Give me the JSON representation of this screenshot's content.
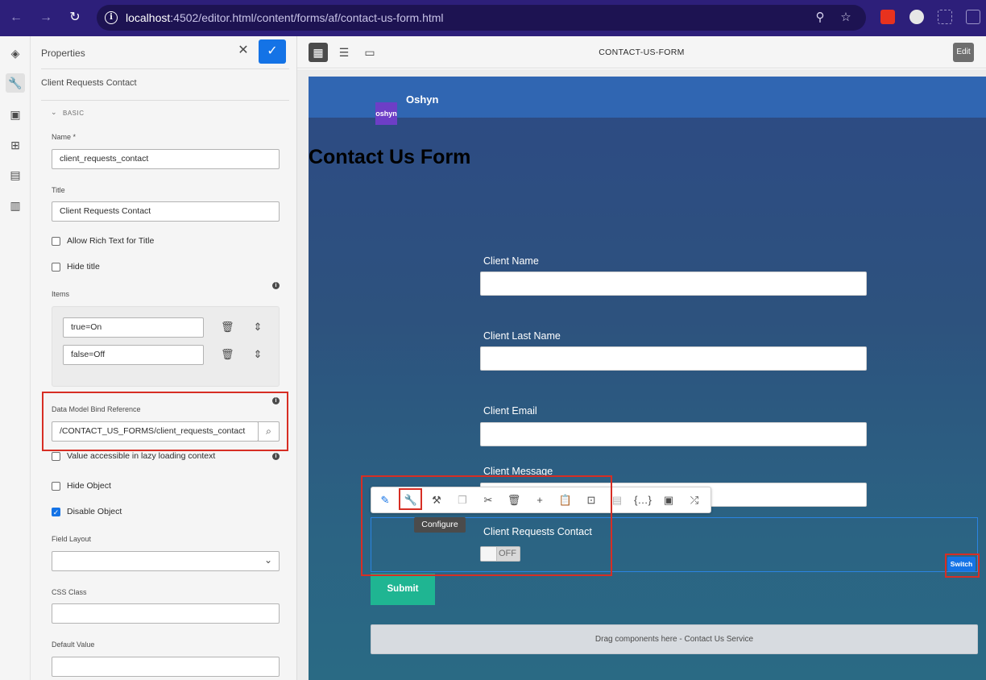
{
  "browser": {
    "url_host": "localhost",
    "url_path": ":4502/editor.html/content/forms/af/contact-us-form.html"
  },
  "properties": {
    "title": "Properties",
    "component": "Client Requests Contact",
    "section": "BASIC",
    "name_label": "Name *",
    "name_value": "client_requests_contact",
    "title_label": "Title",
    "title_value": "Client Requests Contact",
    "rich_text_label": "Allow Rich Text for Title",
    "hide_title_label": "Hide title",
    "items_label": "Items",
    "items": [
      "true=On",
      "false=Off"
    ],
    "bind_label": "Data Model Bind Reference",
    "bind_value": "/CONTACT_US_FORMS/client_requests_contact",
    "lazy_label": "Value accessible in lazy loading context",
    "hide_object_label": "Hide Object",
    "disable_object_label": "Disable Object",
    "field_layout_label": "Field Layout",
    "css_class_label": "CSS Class",
    "default_value_label": "Default Value"
  },
  "editor": {
    "page_title": "CONTACT-US-FORM",
    "edit_label": "Edit"
  },
  "form": {
    "logo_text": "oshyn",
    "brand": "Oshyn",
    "title": "Contact Us Form",
    "fields": [
      "Client Name",
      "Client Last Name",
      "Client Email",
      "Client Message"
    ],
    "requests_label": "Client Requests Contact",
    "toggle_text": "OFF",
    "switch_label": "Switch",
    "submit_label": "Submit",
    "dropzone_text": "Drag components here - Contact Us Service"
  },
  "component_toolbar": {
    "tooltip": "Configure"
  },
  "colors": {
    "accent": "#1473e6",
    "highlight": "#d72e24",
    "browser_bar": "#2d1f7a",
    "submit": "#1fb592"
  }
}
